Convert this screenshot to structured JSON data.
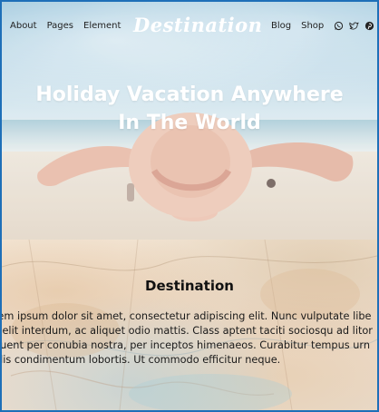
{
  "nav": {
    "left_links": [
      "About",
      "Pages",
      "Element"
    ],
    "logo": "Destination",
    "right_links": [
      "Blog",
      "Shop"
    ],
    "social_icons": [
      "whatsapp-icon",
      "twitter-icon",
      "pinterest-icon"
    ]
  },
  "hero": {
    "title_line1": "Holiday Vacation Anywhere",
    "title_line2": "In The World"
  },
  "section": {
    "title": "Destination",
    "lines": [
      "rem ipsum dolor sit amet, consectetur adipiscing elit. Nunc vulputate libe",
      "s elit interdum, ac aliquet odio mattis. Class aptent taciti sociosqu ad litor",
      "quent per conubia nostra, per inceptos himenaeos. Curabitur tempus urn",
      "ulis condimentum lobortis. Ut commodo efficitur neque."
    ]
  },
  "colors": {
    "frame_border": "#1e6fb8",
    "text_dark": "#111111",
    "hero_text": "#ffffff"
  }
}
